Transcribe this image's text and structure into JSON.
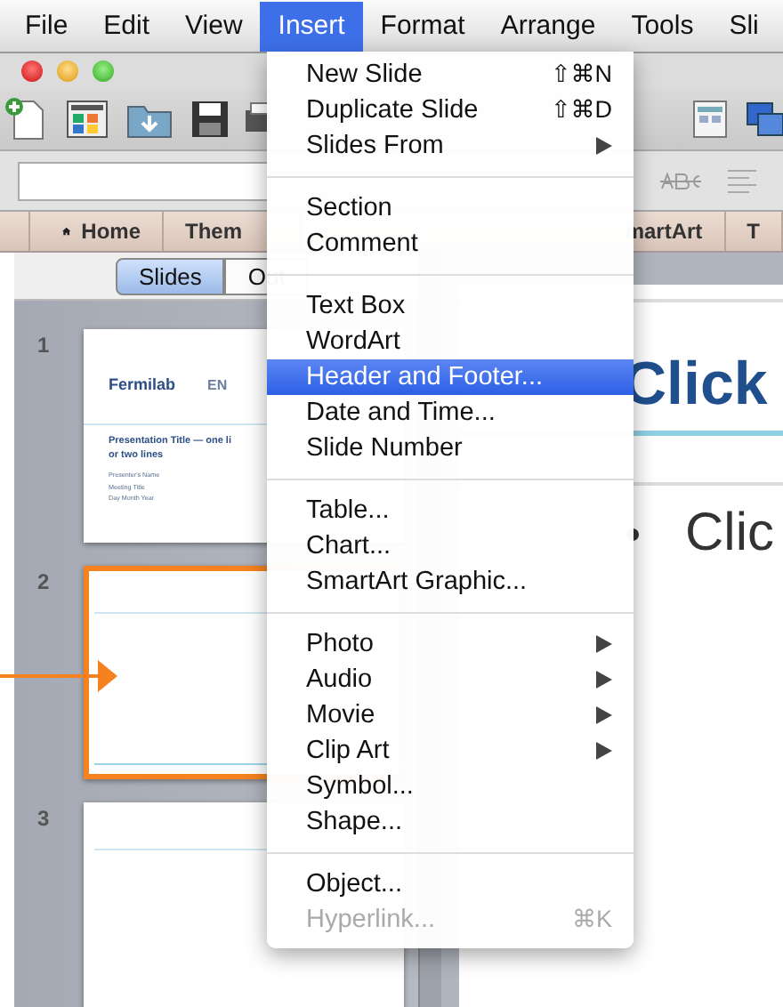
{
  "menubar": [
    {
      "label": "File",
      "selected": false
    },
    {
      "label": "Edit",
      "selected": false
    },
    {
      "label": "View",
      "selected": false
    },
    {
      "label": "Insert",
      "selected": true
    },
    {
      "label": "Format",
      "selected": false
    },
    {
      "label": "Arrange",
      "selected": false
    },
    {
      "label": "Tools",
      "selected": false
    },
    {
      "label": "Sli",
      "selected": false
    }
  ],
  "ribbon_tabs": [
    {
      "label": "Home",
      "kind": "home"
    },
    {
      "label": "Them",
      "kind": "plain"
    },
    {
      "label": "martArt",
      "kind": "plain"
    },
    {
      "label": "T",
      "kind": "plain"
    }
  ],
  "view_tabs": [
    {
      "label": "Slides",
      "selected": true
    },
    {
      "label": "Out",
      "selected": false
    }
  ],
  "slides": [
    {
      "number": "1",
      "selected": false,
      "kind": "title",
      "logo": "Fermilab",
      "logo_2": "EN",
      "title": "Presentation Title — one li",
      "title_2": "or two lines",
      "lines": [
        "Presenter's Name",
        "Meeting Title",
        "Day Month Year"
      ]
    },
    {
      "number": "2",
      "selected": true,
      "kind": "blank"
    },
    {
      "number": "3",
      "selected": false,
      "kind": "blank"
    }
  ],
  "slide": {
    "title": "Click",
    "bullet": "Clic"
  },
  "insert_menu": [
    [
      {
        "label": "New Slide",
        "shortcut": "⇧⌘N",
        "submenu": false,
        "disabled": false,
        "selected": false
      },
      {
        "label": "Duplicate Slide",
        "shortcut": "⇧⌘D",
        "submenu": false,
        "disabled": false,
        "selected": false
      },
      {
        "label": "Slides From",
        "submenu": true,
        "disabled": false,
        "selected": false
      }
    ],
    [
      {
        "label": "Section",
        "submenu": false,
        "disabled": false,
        "selected": false
      },
      {
        "label": "Comment",
        "submenu": false,
        "disabled": false,
        "selected": false
      }
    ],
    [
      {
        "label": "Text Box",
        "submenu": false,
        "disabled": false,
        "selected": false
      },
      {
        "label": "WordArt",
        "submenu": false,
        "disabled": false,
        "selected": false
      },
      {
        "label": "Header and Footer...",
        "submenu": false,
        "disabled": false,
        "selected": true
      },
      {
        "label": "Date and Time...",
        "submenu": false,
        "disabled": false,
        "selected": false
      },
      {
        "label": "Slide Number",
        "submenu": false,
        "disabled": false,
        "selected": false
      }
    ],
    [
      {
        "label": "Table...",
        "submenu": false,
        "disabled": false,
        "selected": false
      },
      {
        "label": "Chart...",
        "submenu": false,
        "disabled": false,
        "selected": false
      },
      {
        "label": "SmartArt Graphic...",
        "submenu": false,
        "disabled": false,
        "selected": false
      }
    ],
    [
      {
        "label": "Photo",
        "submenu": true,
        "disabled": false,
        "selected": false
      },
      {
        "label": "Audio",
        "submenu": true,
        "disabled": false,
        "selected": false
      },
      {
        "label": "Movie",
        "submenu": true,
        "disabled": false,
        "selected": false
      },
      {
        "label": "Clip Art",
        "submenu": true,
        "disabled": false,
        "selected": false
      },
      {
        "label": "Symbol...",
        "submenu": false,
        "disabled": false,
        "selected": false
      },
      {
        "label": "Shape...",
        "submenu": false,
        "disabled": false,
        "selected": false
      }
    ],
    [
      {
        "label": "Object...",
        "submenu": false,
        "disabled": false,
        "selected": false
      },
      {
        "label": "Hyperlink...",
        "shortcut": "⌘K",
        "submenu": false,
        "disabled": true,
        "selected": false
      }
    ]
  ]
}
